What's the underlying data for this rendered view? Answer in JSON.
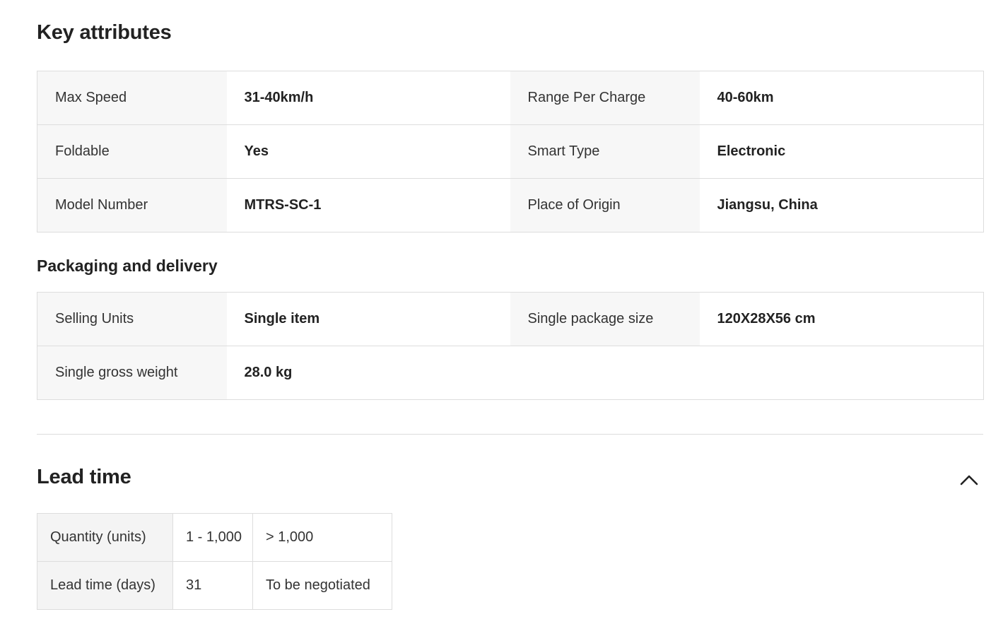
{
  "key_attributes": {
    "title": "Key attributes",
    "rows": [
      [
        {
          "label": "Max Speed",
          "value": "31-40km/h"
        },
        {
          "label": "Range Per Charge",
          "value": "40-60km"
        }
      ],
      [
        {
          "label": "Foldable",
          "value": "Yes"
        },
        {
          "label": "Smart Type",
          "value": "Electronic"
        }
      ],
      [
        {
          "label": "Model Number",
          "value": "MTRS-SC-1"
        },
        {
          "label": "Place of Origin",
          "value": "Jiangsu, China"
        }
      ]
    ]
  },
  "packaging": {
    "title": "Packaging and delivery",
    "rows": [
      [
        {
          "label": "Selling Units",
          "value": "Single item"
        },
        {
          "label": "Single package size",
          "value": "120X28X56 cm"
        }
      ],
      [
        {
          "label": "Single gross weight",
          "value": "28.0 kg"
        }
      ]
    ]
  },
  "lead_time": {
    "title": "Lead time",
    "collapse_icon": "chevron-up-icon",
    "quantity_label": "Quantity (units)",
    "days_label": "Lead time (days)",
    "columns": [
      {
        "quantity": "1 - 1,000",
        "days": "31"
      },
      {
        "quantity": "> 1,000",
        "days": "To be negotiated"
      }
    ]
  }
}
